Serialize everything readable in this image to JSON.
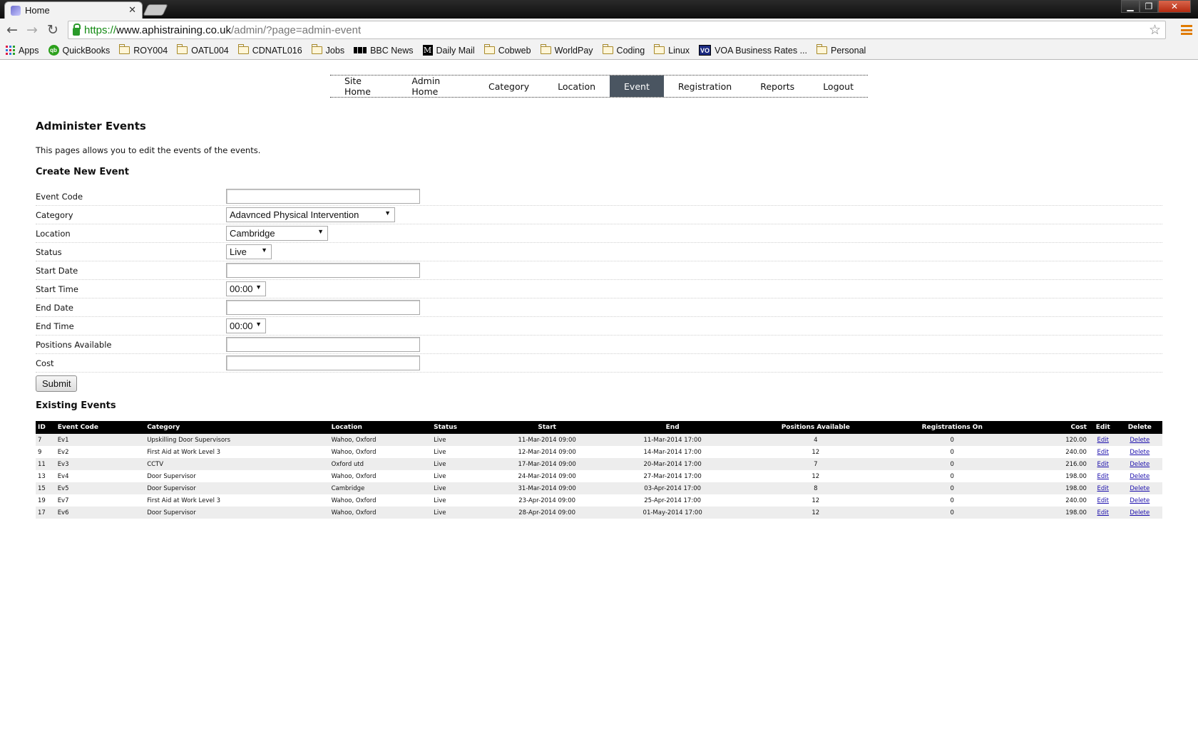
{
  "browser": {
    "tab_title": "Home",
    "url_https": "https://",
    "url_host": "www.aphistraining.co.uk",
    "url_path": "/admin/?page=admin-event",
    "bookmarks": [
      "Apps",
      "QuickBooks",
      "ROY004",
      "OATL004",
      "CDNATL016",
      "Jobs",
      "BBC News",
      "Daily Mail",
      "Cobweb",
      "WorldPay",
      "Coding",
      "Linux",
      "VOA Business Rates ...",
      "Personal"
    ]
  },
  "nav": {
    "items": [
      "Site Home",
      "Admin Home",
      "Category",
      "Location",
      "Event",
      "Registration",
      "Reports",
      "Logout"
    ],
    "active": "Event"
  },
  "page": {
    "title": "Administer Events",
    "intro": "This pages allows you to edit the events of the events.",
    "create_heading": "Create New Event",
    "existing_heading": "Existing Events"
  },
  "form": {
    "event_code_label": "Event Code",
    "category_label": "Category",
    "category_value": "Adavnced Physical Intervention",
    "location_label": "Location",
    "location_value": "Cambridge",
    "status_label": "Status",
    "status_value": "Live",
    "start_date_label": "Start Date",
    "start_time_label": "Start Time",
    "start_time_value": "00:00",
    "end_date_label": "End Date",
    "end_time_label": "End Time",
    "end_time_value": "00:00",
    "positions_label": "Positions Available",
    "cost_label": "Cost",
    "submit_label": "Submit"
  },
  "table": {
    "headers": [
      "ID",
      "Event Code",
      "Category",
      "Location",
      "Status",
      "Start",
      "End",
      "Positions Available",
      "Registrations On",
      "Cost",
      "Edit",
      "Delete"
    ],
    "rows": [
      [
        "7",
        "Ev1",
        "Upskilling Door Supervisors",
        "Wahoo, Oxford",
        "Live",
        "11-Mar-2014 09:00",
        "11-Mar-2014 17:00",
        "4",
        "0",
        "120.00",
        "Edit",
        "Delete"
      ],
      [
        "9",
        "Ev2",
        "First Aid at Work Level 3",
        "Wahoo, Oxford",
        "Live",
        "12-Mar-2014 09:00",
        "14-Mar-2014 17:00",
        "12",
        "0",
        "240.00",
        "Edit",
        "Delete"
      ],
      [
        "11",
        "Ev3",
        "CCTV",
        "Oxford utd",
        "Live",
        "17-Mar-2014 09:00",
        "20-Mar-2014 17:00",
        "7",
        "0",
        "216.00",
        "Edit",
        "Delete"
      ],
      [
        "13",
        "Ev4",
        "Door Supervisor",
        "Wahoo, Oxford",
        "Live",
        "24-Mar-2014 09:00",
        "27-Mar-2014 17:00",
        "12",
        "0",
        "198.00",
        "Edit",
        "Delete"
      ],
      [
        "15",
        "Ev5",
        "Door Supervisor",
        "Cambridge",
        "Live",
        "31-Mar-2014 09:00",
        "03-Apr-2014 17:00",
        "8",
        "0",
        "198.00",
        "Edit",
        "Delete"
      ],
      [
        "19",
        "Ev7",
        "First Aid at Work Level 3",
        "Wahoo, Oxford",
        "Live",
        "23-Apr-2014 09:00",
        "25-Apr-2014 17:00",
        "12",
        "0",
        "240.00",
        "Edit",
        "Delete"
      ],
      [
        "17",
        "Ev6",
        "Door Supervisor",
        "Wahoo, Oxford",
        "Live",
        "28-Apr-2014 09:00",
        "01-May-2014 17:00",
        "12",
        "0",
        "198.00",
        "Edit",
        "Delete"
      ]
    ]
  }
}
